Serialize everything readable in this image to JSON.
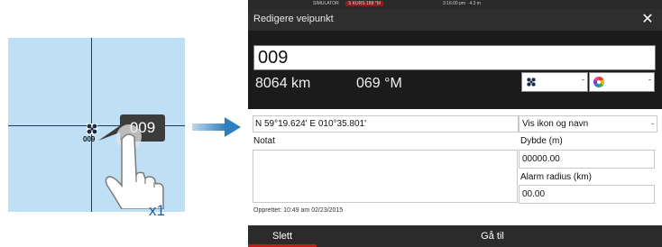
{
  "illustration": {
    "waypoint_label": "009",
    "tooltip_text": "009",
    "tap_count": "x1"
  },
  "statusbar": {
    "left_text": "SIMULATOR",
    "badge_text": "S KURS 188 °M",
    "center_text": "3:16:00 pm · 4.3 m"
  },
  "dialog": {
    "title": "Redigere veipunkt",
    "close_label": "✕",
    "name_value": "009",
    "distance": "8064 km",
    "bearing": "069 °M",
    "position": "N 59°19.624'  E 010°35.801'",
    "notes_label": "Notat",
    "notes_value": "",
    "show_option": "Vis ikon og navn",
    "depth_label": "Dybde (m)",
    "depth_value": "00000.00",
    "alarm_label": "Alarm radius (km)",
    "alarm_value": "00.00",
    "created": "Opprettet: 10:49 am  02/23/2015",
    "delete_label": "Slett",
    "goto_label": "Gå til",
    "dropdown_glyph": "-"
  },
  "colors": {
    "map_water": "#bfe0f4",
    "dialog_bg": "#1b1b1b",
    "delete_accent": "#c41a1a",
    "arrow": "#2f7fbf"
  },
  "icons": [
    "waypoint-icon",
    "pointing-hand-icon",
    "arrow-right-icon",
    "close-icon",
    "color-wheel-icon"
  ]
}
